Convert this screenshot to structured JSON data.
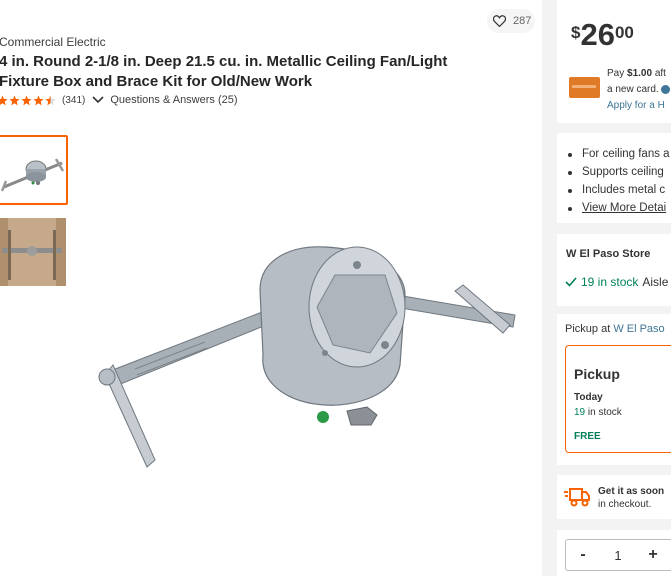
{
  "product": {
    "brand": "Commercial Electric",
    "title_line1": "4 in. Round 2-1/8 in. Deep 21.5 cu. in. Metallic Ceiling Fan/Light",
    "title_line2": "Fixture Box and Brace Kit for Old/New Work",
    "rating_value": 4.5,
    "review_count": "(341)",
    "qa_label": "Questions & Answers (25)",
    "favorites_count": "287",
    "thumbnails": [
      "thumbnail-fan-box-brace",
      "thumbnail-installed-brace"
    ]
  },
  "buybox": {
    "price_currency": "$",
    "price_dollars": "26",
    "price_cents": "00",
    "promo_line1_pre": "Pay ",
    "promo_line1_bold": "$1.00",
    "promo_line1_post": " aft",
    "promo_line2": "a new card.",
    "promo_link": "Apply for a H",
    "bullets": [
      "For ceiling fans a",
      "Supports ceiling",
      "Includes metal c"
    ],
    "view_more": "View More Detai",
    "store_name": "W El Paso Store",
    "stock_text": "19 in stock",
    "aisle_text": "Aisle",
    "pickup_at_label": "Pickup at ",
    "pickup_store_link": "W El Paso",
    "pickup_title": "Pickup",
    "pickup_today": "Today",
    "pickup_stock_num": "19",
    "pickup_stock_text": " in stock",
    "pickup_free": "FREE",
    "ship_line1": "Get it as soon",
    "ship_line2": "in checkout.",
    "qty_minus": "-",
    "qty_value": "1",
    "qty_plus": "+"
  },
  "colors": {
    "accent": "#f96302",
    "in_stock_green": "#00805a",
    "link_blue": "#3e7697",
    "star_orange": "#f96302"
  }
}
